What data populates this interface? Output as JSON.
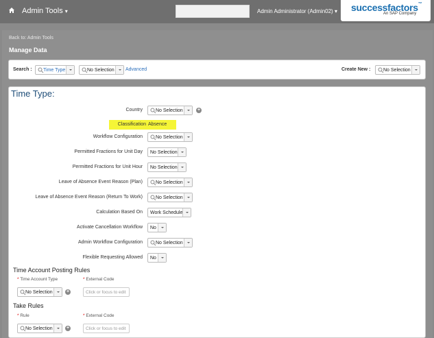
{
  "header": {
    "app_title": "Admin Tools",
    "user": "Admin Administrator (Admin02)",
    "logo_brand": "successfactors",
    "logo_sub": "An SAP Company"
  },
  "page": {
    "back_link": "Back to: Admin Tools",
    "title": "Manage Data"
  },
  "search_bar": {
    "search_label": "Search :",
    "search_type": "Time Type",
    "search_value": "No Selection",
    "advanced": "Advanced",
    "create_label": "Create New :",
    "create_value": "No Selection"
  },
  "form": {
    "title": "Time Type:",
    "fields": {
      "country": {
        "label": "Country",
        "value": "No Selection"
      },
      "classification": {
        "label": "Classification",
        "value": "Absence"
      },
      "workflow_config": {
        "label": "Workflow Configuration",
        "value": "No Selection"
      },
      "fractions_day": {
        "label": "Permitted Fractions for Unit Day",
        "value": "No Selection"
      },
      "fractions_hour": {
        "label": "Permitted Fractions for Unit Hour",
        "value": "No Selection"
      },
      "loa_plan": {
        "label": "Leave of Absence Event Reason (Plan)",
        "value": "No Selection"
      },
      "loa_return": {
        "label": "Leave of Absence Event Reason (Return To Work)",
        "value": "No Selection"
      },
      "calc_based_on": {
        "label": "Calculation Based On",
        "value": "Work Schedule"
      },
      "activate_cancel": {
        "label": "Activate Cancellation Workflow",
        "value": "No"
      },
      "admin_workflow": {
        "label": "Admin Workflow Configuration",
        "value": "No Selection"
      },
      "flex_requesting": {
        "label": "Flexible Requesting Allowed",
        "value": "No"
      }
    },
    "time_account_section": {
      "title": "Time Account Posting Rules",
      "col1": "Time Account Type",
      "col2": "External Code",
      "select_value": "No Selection",
      "input_placeholder": "Click or focus to edit"
    },
    "take_rules_section": {
      "title": "Take Rules",
      "col1": "Rule",
      "col2": "External Code",
      "select_value": "No Selection",
      "input_placeholder": "Click or focus to edit"
    },
    "required_mark": "*"
  }
}
